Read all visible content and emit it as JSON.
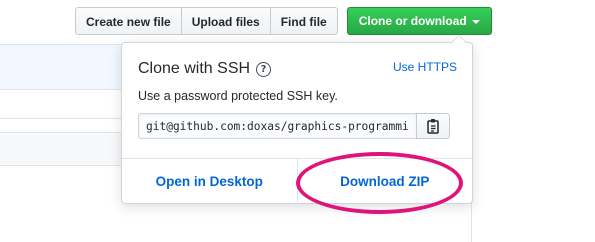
{
  "toolbar": {
    "create_new_file": "Create new file",
    "upload_files": "Upload files",
    "find_file": "Find file",
    "clone_or_download": "Clone or download"
  },
  "clone_panel": {
    "title": "Clone with SSH",
    "use_https": "Use HTTPS",
    "description": "Use a password protected SSH key.",
    "url_value": "git@github.com:doxas/graphics-programming.git",
    "open_in_desktop": "Open in Desktop",
    "download_zip": "Download ZIP"
  },
  "colors": {
    "primary_green": "#2ea44f",
    "link_blue": "#0366d6",
    "annotation_pink": "#e0137a"
  },
  "icons": {
    "help": "question-circle-icon",
    "copy": "clippy-icon",
    "caret": "caret-down-icon"
  }
}
